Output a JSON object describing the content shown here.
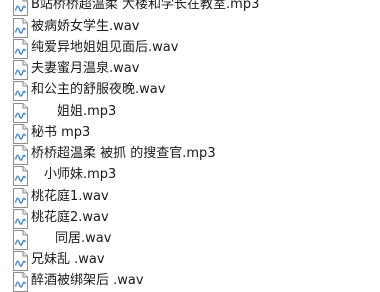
{
  "file_list": {
    "items": [
      {
        "name": "B站桥桥超温柔 大楼和学长在教室.mp3",
        "icon": "audio-file-icon"
      },
      {
        "name": "被病娇女学生.wav",
        "icon": "audio-file-icon"
      },
      {
        "name": "纯爱异地姐姐见面后.wav",
        "icon": "audio-file-icon"
      },
      {
        "name": "夫妻蜜月温泉.wav",
        "icon": "audio-file-icon"
      },
      {
        "name": "和公主的舒服夜晚.wav",
        "icon": "audio-file-icon"
      },
      {
        "name": "姐姐.mp3",
        "icon": "audio-file-icon"
      },
      {
        "name": "秘书 mp3",
        "icon": "audio-file-icon"
      },
      {
        "name": "桥桥超温柔 被抓 的搜查官.mp3",
        "icon": "audio-file-icon"
      },
      {
        "name": "小师妹.mp3",
        "icon": "audio-file-icon"
      },
      {
        "name": "桃花庭1.wav",
        "icon": "audio-file-icon"
      },
      {
        "name": "桃花庭2.wav",
        "icon": "audio-file-icon"
      },
      {
        "name": "同居.wav",
        "icon": "audio-file-icon"
      },
      {
        "name": "兄妹乱 .wav",
        "icon": "audio-file-icon"
      },
      {
        "name": "醉酒被绑架后 .wav",
        "icon": "audio-file-icon"
      }
    ]
  }
}
